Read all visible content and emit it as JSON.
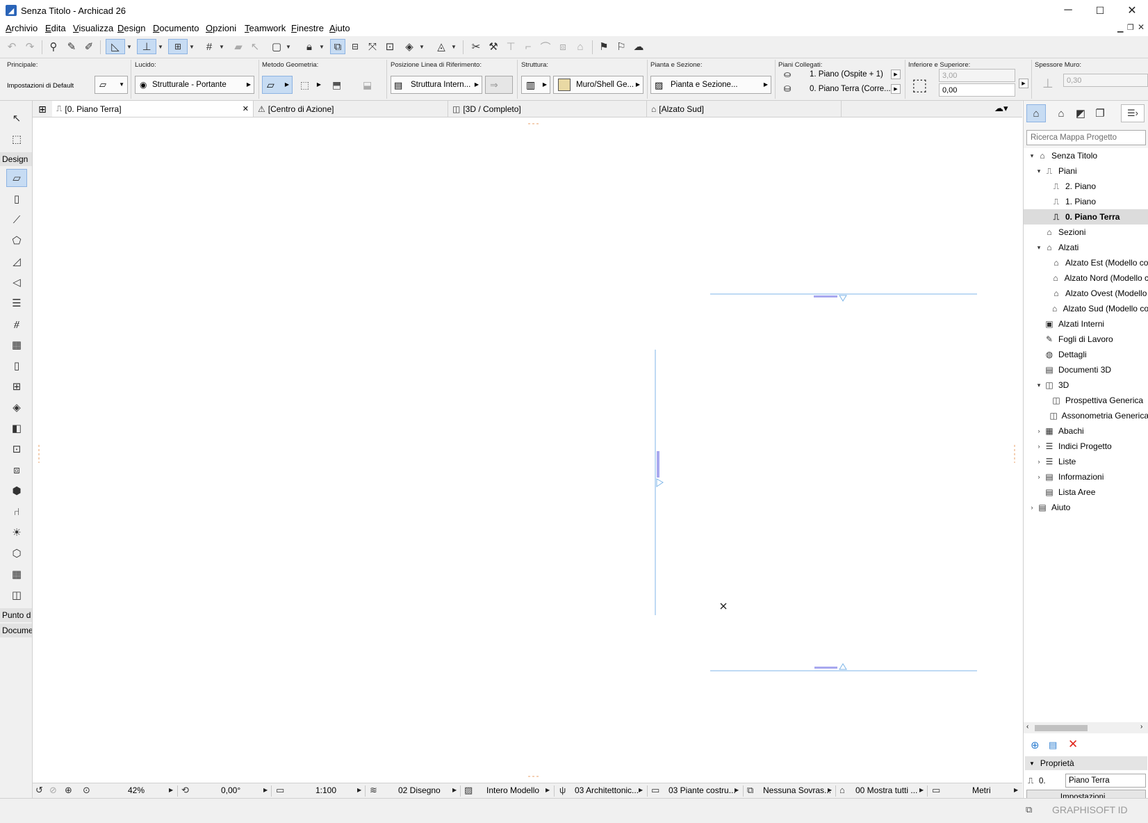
{
  "window": {
    "title": "Senza Titolo - Archicad 26",
    "minimize": "─",
    "maximize": "☐",
    "close": "✕"
  },
  "menu": [
    "Archivio",
    "Edita",
    "Visualizza",
    "Design",
    "Documento",
    "Opzioni",
    "Teamwork",
    "Finestre",
    "Aiuto"
  ],
  "infobox": {
    "principale_label": "Principale:",
    "principale_value": "Impostazioni di Default",
    "lucido_label": "Lucido:",
    "lucido_value": "Strutturale - Portante",
    "metodo_label": "Metodo Geometria:",
    "posizione_label": "Posizione Linea di Riferimento:",
    "posizione_value": "Struttura Intern...",
    "struttura_label": "Struttura:",
    "struttura_value": "Muro/Shell Ge...",
    "pianta_label": "Pianta e Sezione:",
    "pianta_value": "Pianta e Sezione...",
    "piani_label": "Piani Collegati:",
    "piano_top": "1. Piano (Ospite + 1)",
    "piano_bottom": "0. Piano Terra (Corre...",
    "infsup_label": "Inferiore e Superiore:",
    "top_value": "3,00",
    "bottom_value": "0,00",
    "spessore_label": "Spessore Muro:",
    "spessore_value": "0,30"
  },
  "toolbox": {
    "design_label": "Design",
    "punto_label": "Punto d",
    "docume_label": "Docume"
  },
  "tabs": {
    "plan": "[0. Piano Terra]",
    "action": "[Centro di Azione]",
    "view3d": "[3D / Completo]",
    "elevation": "[Alzato Sud]",
    "close": "✕"
  },
  "navigator": {
    "search_placeholder": "Ricerca Mappa Progetto",
    "tree": [
      {
        "label": "Senza Titolo",
        "level": 0,
        "exp": "▾",
        "icon": "⌂"
      },
      {
        "label": "Piani",
        "level": 1,
        "exp": "▾",
        "icon": "⎍"
      },
      {
        "label": "2. Piano",
        "level": 2,
        "exp": "",
        "icon": "⎍"
      },
      {
        "label": "1. Piano",
        "level": 2,
        "exp": "",
        "icon": "⎍"
      },
      {
        "label": "0. Piano Terra",
        "level": 2,
        "exp": "",
        "icon": "⎍",
        "selected": true
      },
      {
        "label": "Sezioni",
        "level": 1,
        "exp": "",
        "icon": "⌂"
      },
      {
        "label": "Alzati",
        "level": 1,
        "exp": "▾",
        "icon": "⌂"
      },
      {
        "label": "Alzato Est (Modello co",
        "level": 2,
        "exp": "",
        "icon": "⌂"
      },
      {
        "label": "Alzato Nord (Modello c",
        "level": 2,
        "exp": "",
        "icon": "⌂"
      },
      {
        "label": "Alzato Ovest (Modello",
        "level": 2,
        "exp": "",
        "icon": "⌂"
      },
      {
        "label": "Alzato Sud (Modello co",
        "level": 2,
        "exp": "",
        "icon": "⌂"
      },
      {
        "label": "Alzati Interni",
        "level": 1,
        "exp": "",
        "icon": "▣"
      },
      {
        "label": "Fogli di Lavoro",
        "level": 1,
        "exp": "",
        "icon": "✎"
      },
      {
        "label": "Dettagli",
        "level": 1,
        "exp": "",
        "icon": "◍"
      },
      {
        "label": "Documenti 3D",
        "level": 1,
        "exp": "",
        "icon": "▤"
      },
      {
        "label": "3D",
        "level": 1,
        "exp": "▾",
        "icon": "◫"
      },
      {
        "label": "Prospettiva Generica",
        "level": 2,
        "exp": "",
        "icon": "◫"
      },
      {
        "label": "Assonometria Generica",
        "level": 2,
        "exp": "",
        "icon": "◫"
      },
      {
        "label": "Abachi",
        "level": 1,
        "exp": "›",
        "icon": "▦"
      },
      {
        "label": "Indici Progetto",
        "level": 1,
        "exp": "›",
        "icon": "☰"
      },
      {
        "label": "Liste",
        "level": 1,
        "exp": "›",
        "icon": "☰"
      },
      {
        "label": "Informazioni",
        "level": 1,
        "exp": "›",
        "icon": "▤"
      },
      {
        "label": "Lista Aree",
        "level": 1,
        "exp": "",
        "icon": "▤"
      },
      {
        "label": "Aiuto",
        "level": 0,
        "exp": "›",
        "icon": "▤"
      }
    ],
    "properties_label": "Proprietà",
    "prop_id": "0.",
    "prop_name": "Piano Terra",
    "settings_button": "Impostazioni...",
    "graphisoft": "GRAPHISOFT ID"
  },
  "statusbar": {
    "zoom": "42%",
    "rotation": "0,00°",
    "scale": "1:100",
    "layer_combo": "02 Disegno",
    "model": "Intero Modello",
    "pen_set": "03 Architettonic...",
    "mvo": "03 Piante costru...",
    "override": "Nessuna Sovras...",
    "renovation": "00 Mostra tutti ...",
    "units": "Metri"
  },
  "colors": {
    "accent": "#2a64b8",
    "selection_line": "#7fb6e8",
    "marker": "#a8a8ef"
  }
}
